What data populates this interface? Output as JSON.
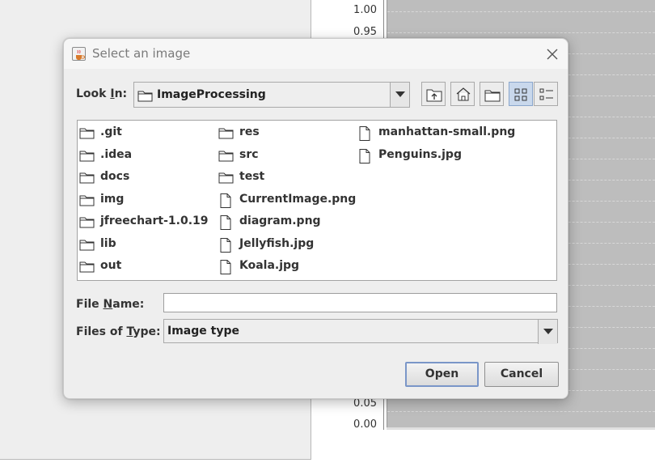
{
  "background_chart": {
    "y_ticks_visible": [
      "1.00",
      "0.95",
      "0.05",
      "0.00"
    ]
  },
  "dialog": {
    "title": "Select an image",
    "icons": {
      "app": "java-cup-icon",
      "close": "close-icon"
    },
    "look_in": {
      "label_pre": "Look ",
      "label_mnemonic": "I",
      "label_post": "n:",
      "value": "ImageProcessing"
    },
    "toolbar": {
      "up_one_level": "up-folder-icon",
      "home": "home-icon",
      "new_folder": "new-folder-icon",
      "list_view": "list-view-icon",
      "details_view": "details-view-icon"
    },
    "files": {
      "col1": [
        ".git",
        ".idea",
        "docs",
        "img",
        "jfreechart-1.0.19",
        "lib",
        "out"
      ],
      "col2_folders": [
        "res",
        "src",
        "test"
      ],
      "col2_files": [
        "CurrentImage.png",
        "diagram.png",
        "Jellyfish.jpg",
        "Koala.jpg"
      ],
      "col3_files": [
        "manhattan-small.png",
        "Penguins.jpg"
      ]
    },
    "file_name": {
      "label_pre": "File ",
      "label_mnemonic": "N",
      "label_post": "ame:",
      "value": ""
    },
    "files_of_type": {
      "label_pre": "Files of ",
      "label_mnemonic": "T",
      "label_post": "ype:",
      "value": "Image type"
    },
    "buttons": {
      "open": "Open",
      "cancel": "Cancel"
    }
  }
}
